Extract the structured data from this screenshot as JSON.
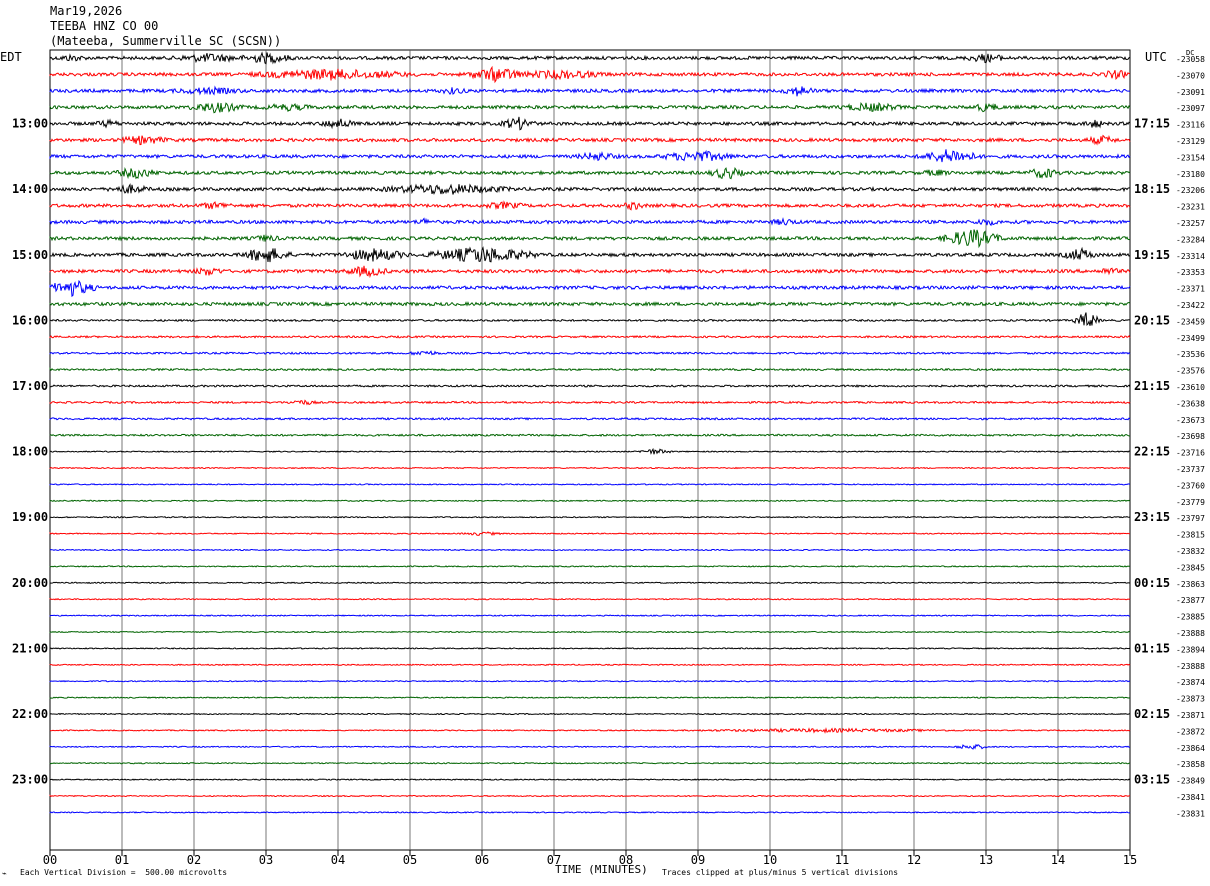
{
  "header": {
    "date": "Mar19,2026",
    "station": "TEEBA HNZ CO 00",
    "location": "(Mateeba, Summerville SC (SCSN))"
  },
  "left_tz": "EDT",
  "right_tz": "UTC",
  "dc_label": "DC",
  "footer": {
    "scale": "Each Vertical Division =  500.00 microvolts",
    "xlabel": "TIME (MINUTES)",
    "clip": "Traces clipped at plus/minus 5 vertical divisions"
  },
  "chart_data": {
    "type": "line",
    "title": "TEEBA HNZ CO 00",
    "xlabel": "TIME (MINUTES)",
    "x_ticks": [
      "00",
      "01",
      "02",
      "03",
      "04",
      "05",
      "06",
      "07",
      "08",
      "09",
      "10",
      "11",
      "12",
      "13",
      "14",
      "15"
    ],
    "xlim": [
      0,
      15
    ],
    "grid": true,
    "trace_colors": [
      "#000000",
      "#ff0000",
      "#0000ff",
      "#006400"
    ],
    "hour_labels_left": [
      {
        "row": 4,
        "text": "13:00"
      },
      {
        "row": 8,
        "text": "14:00"
      },
      {
        "row": 12,
        "text": "15:00"
      },
      {
        "row": 16,
        "text": "16:00"
      },
      {
        "row": 20,
        "text": "17:00"
      },
      {
        "row": 24,
        "text": "18:00"
      },
      {
        "row": 28,
        "text": "19:00"
      },
      {
        "row": 32,
        "text": "20:00"
      },
      {
        "row": 36,
        "text": "21:00"
      },
      {
        "row": 40,
        "text": "22:00"
      },
      {
        "row": 44,
        "text": "23:00"
      }
    ],
    "hour_labels_right": [
      {
        "row": 4,
        "text": "17:15"
      },
      {
        "row": 8,
        "text": "18:15"
      },
      {
        "row": 12,
        "text": "19:15"
      },
      {
        "row": 16,
        "text": "20:15"
      },
      {
        "row": 20,
        "text": "21:15"
      },
      {
        "row": 24,
        "text": "22:15"
      },
      {
        "row": 28,
        "text": "23:15"
      },
      {
        "row": 32,
        "text": "00:15"
      },
      {
        "row": 36,
        "text": "01:15"
      },
      {
        "row": 40,
        "text": "02:15"
      },
      {
        "row": 44,
        "text": "03:15"
      }
    ],
    "dc_offsets": [
      "-23058",
      "-23070",
      "-23091",
      "-23097",
      "-23116",
      "-23129",
      "-23154",
      "-23180",
      "-23206",
      "-23231",
      "-23257",
      "-23284",
      "-23314",
      "-23353",
      "-23371",
      "-23422",
      "-23459",
      "-23499",
      "-23536",
      "-23576",
      "-23610",
      "-23638",
      "-23673",
      "-23698",
      "-23716",
      "-23737",
      "-23760",
      "-23779",
      "-23797",
      "-23815",
      "-23832",
      "-23845",
      "-23863",
      "-23877",
      "-23885",
      "-23888",
      "-23894",
      "-23888",
      "-23874",
      "-23873",
      "-23871",
      "-23872",
      "-23864",
      "-23858",
      "-23849",
      "-23841",
      "-23831"
    ]
  }
}
